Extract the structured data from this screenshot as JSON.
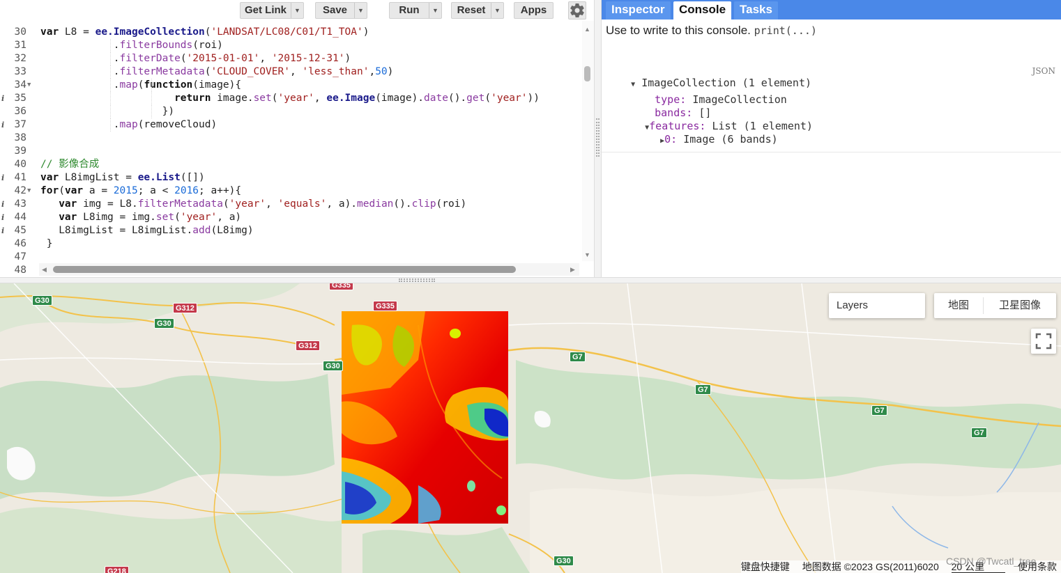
{
  "toolbar": {
    "get_link": "Get Link",
    "save": "Save",
    "run": "Run",
    "reset": "Reset",
    "apps": "Apps",
    "dropdown_icon": "caret-down-icon",
    "settings_icon": "gear-icon"
  },
  "editor": {
    "lines": [
      {
        "n": "30",
        "parts": [
          [
            "kw",
            "var"
          ],
          [
            "t",
            " L8 = "
          ],
          [
            "ee",
            "ee.ImageCollection"
          ],
          [
            "t",
            "("
          ],
          [
            "str",
            "'LANDSAT/LC08/C01/T1_TOA'"
          ],
          [
            "t",
            ")"
          ]
        ]
      },
      {
        "n": "31",
        "parts": [
          [
            "t",
            "            ."
          ],
          [
            "mth",
            "filterBounds"
          ],
          [
            "t",
            "(roi)"
          ]
        ]
      },
      {
        "n": "32",
        "parts": [
          [
            "t",
            "            ."
          ],
          [
            "mth",
            "filterDate"
          ],
          [
            "t",
            "("
          ],
          [
            "str",
            "'2015-01-01'"
          ],
          [
            "t",
            ", "
          ],
          [
            "str",
            "'2015-12-31'"
          ],
          [
            "t",
            ")"
          ]
        ]
      },
      {
        "n": "33",
        "parts": [
          [
            "t",
            "            ."
          ],
          [
            "mth",
            "filterMetadata"
          ],
          [
            "t",
            "("
          ],
          [
            "str",
            "'CLOUD_COVER'"
          ],
          [
            "t",
            ", "
          ],
          [
            "str",
            "'less_than'"
          ],
          [
            "t",
            ","
          ],
          [
            "num",
            "50"
          ],
          [
            "t",
            ")"
          ]
        ]
      },
      {
        "n": "34",
        "fold": true,
        "parts": [
          [
            "t",
            "            ."
          ],
          [
            "mth",
            "map"
          ],
          [
            "t",
            "("
          ],
          [
            "kw",
            "function"
          ],
          [
            "t",
            "(image){"
          ]
        ]
      },
      {
        "n": "35",
        "info": true,
        "parts": [
          [
            "t",
            "                      "
          ],
          [
            "kw",
            "return"
          ],
          [
            "t",
            " image."
          ],
          [
            "mth",
            "set"
          ],
          [
            "t",
            "("
          ],
          [
            "str",
            "'year'"
          ],
          [
            "t",
            ", "
          ],
          [
            "ee",
            "ee.Image"
          ],
          [
            "t",
            "(image)."
          ],
          [
            "mth",
            "date"
          ],
          [
            "t",
            "()."
          ],
          [
            "mth",
            "get"
          ],
          [
            "t",
            "("
          ],
          [
            "str",
            "'year'"
          ],
          [
            "t",
            "))"
          ]
        ]
      },
      {
        "n": "36",
        "parts": [
          [
            "t",
            "                    })"
          ]
        ]
      },
      {
        "n": "37",
        "info": true,
        "parts": [
          [
            "t",
            "            ."
          ],
          [
            "mth",
            "map"
          ],
          [
            "t",
            "(removeCloud)"
          ]
        ]
      },
      {
        "n": "38",
        "parts": []
      },
      {
        "n": "39",
        "parts": []
      },
      {
        "n": "40",
        "parts": [
          [
            "cm",
            "// 影像合成"
          ]
        ]
      },
      {
        "n": "41",
        "info": true,
        "parts": [
          [
            "kw",
            "var"
          ],
          [
            "t",
            " L8imgList = "
          ],
          [
            "ee",
            "ee.List"
          ],
          [
            "t",
            "([])"
          ]
        ]
      },
      {
        "n": "42",
        "fold": true,
        "parts": [
          [
            "kw",
            "for"
          ],
          [
            "t",
            "("
          ],
          [
            "kw",
            "var"
          ],
          [
            "t",
            " a = "
          ],
          [
            "num",
            "2015"
          ],
          [
            "t",
            "; a < "
          ],
          [
            "num",
            "2016"
          ],
          [
            "t",
            "; a++){"
          ]
        ]
      },
      {
        "n": "43",
        "info": true,
        "parts": [
          [
            "t",
            "   "
          ],
          [
            "kw",
            "var"
          ],
          [
            "t",
            " img = L8."
          ],
          [
            "mth",
            "filterMetadata"
          ],
          [
            "t",
            "("
          ],
          [
            "str",
            "'year'"
          ],
          [
            "t",
            ", "
          ],
          [
            "str",
            "'equals'"
          ],
          [
            "t",
            ", a)."
          ],
          [
            "mth",
            "median"
          ],
          [
            "t",
            "()."
          ],
          [
            "mth",
            "clip"
          ],
          [
            "t",
            "(roi)"
          ]
        ]
      },
      {
        "n": "44",
        "info": true,
        "parts": [
          [
            "t",
            "   "
          ],
          [
            "kw",
            "var"
          ],
          [
            "t",
            " L8img = img."
          ],
          [
            "mth",
            "set"
          ],
          [
            "t",
            "("
          ],
          [
            "str",
            "'year'"
          ],
          [
            "t",
            ", a)"
          ]
        ]
      },
      {
        "n": "45",
        "info": true,
        "parts": [
          [
            "t",
            "   L8imgList = L8imgList."
          ],
          [
            "mth",
            "add"
          ],
          [
            "t",
            "(L8img)"
          ]
        ]
      },
      {
        "n": "46",
        "parts": [
          [
            "t",
            " }"
          ]
        ]
      },
      {
        "n": "47",
        "parts": []
      },
      {
        "n": "48",
        "parts": []
      }
    ]
  },
  "tabs": {
    "inspector": "Inspector",
    "console": "Console",
    "tasks": "Tasks"
  },
  "console": {
    "hint_prefix": "Use to write to this console.",
    "hint_code": "print(...)",
    "json_label": "JSON",
    "tree": {
      "root": "ImageCollection (1 element)",
      "type_key": "type:",
      "type_val": "ImageCollection",
      "bands_key": "bands:",
      "bands_val": "[]",
      "features_key": "features:",
      "features_val": "List (1 element)",
      "item_key": "0:",
      "item_val": "Image (6 bands)"
    }
  },
  "map": {
    "layers_label": "Layers",
    "map_type_roadmap": "地图",
    "map_type_satellite": "卫星图像",
    "fullscreen_icon": "fullscreen-icon",
    "shields": [
      {
        "label": "G30",
        "color": "green"
      },
      {
        "label": "G312",
        "color": "red"
      },
      {
        "label": "G30",
        "color": "green"
      },
      {
        "label": "G335",
        "color": "red"
      },
      {
        "label": "G312",
        "color": "red"
      },
      {
        "label": "G30",
        "color": "green"
      },
      {
        "label": "G7",
        "color": "green"
      },
      {
        "label": "G7",
        "color": "green"
      },
      {
        "label": "G7",
        "color": "green"
      },
      {
        "label": "G7",
        "color": "green"
      },
      {
        "label": "G30",
        "color": "green"
      },
      {
        "label": "G218",
        "color": "red"
      },
      {
        "label": "G335",
        "color": "red"
      }
    ],
    "attribution": {
      "shortcuts": "键盘快捷键",
      "data": "地图数据 ©2023 GS(2011)6020",
      "scale": "20 公里",
      "terms": "使用条款"
    },
    "watermark": "CSDN @Twcatl_tree"
  },
  "colors": {
    "accent_blue": "#4a88e8",
    "shield_green": "#2f8a4a",
    "shield_red": "#c4394b"
  }
}
